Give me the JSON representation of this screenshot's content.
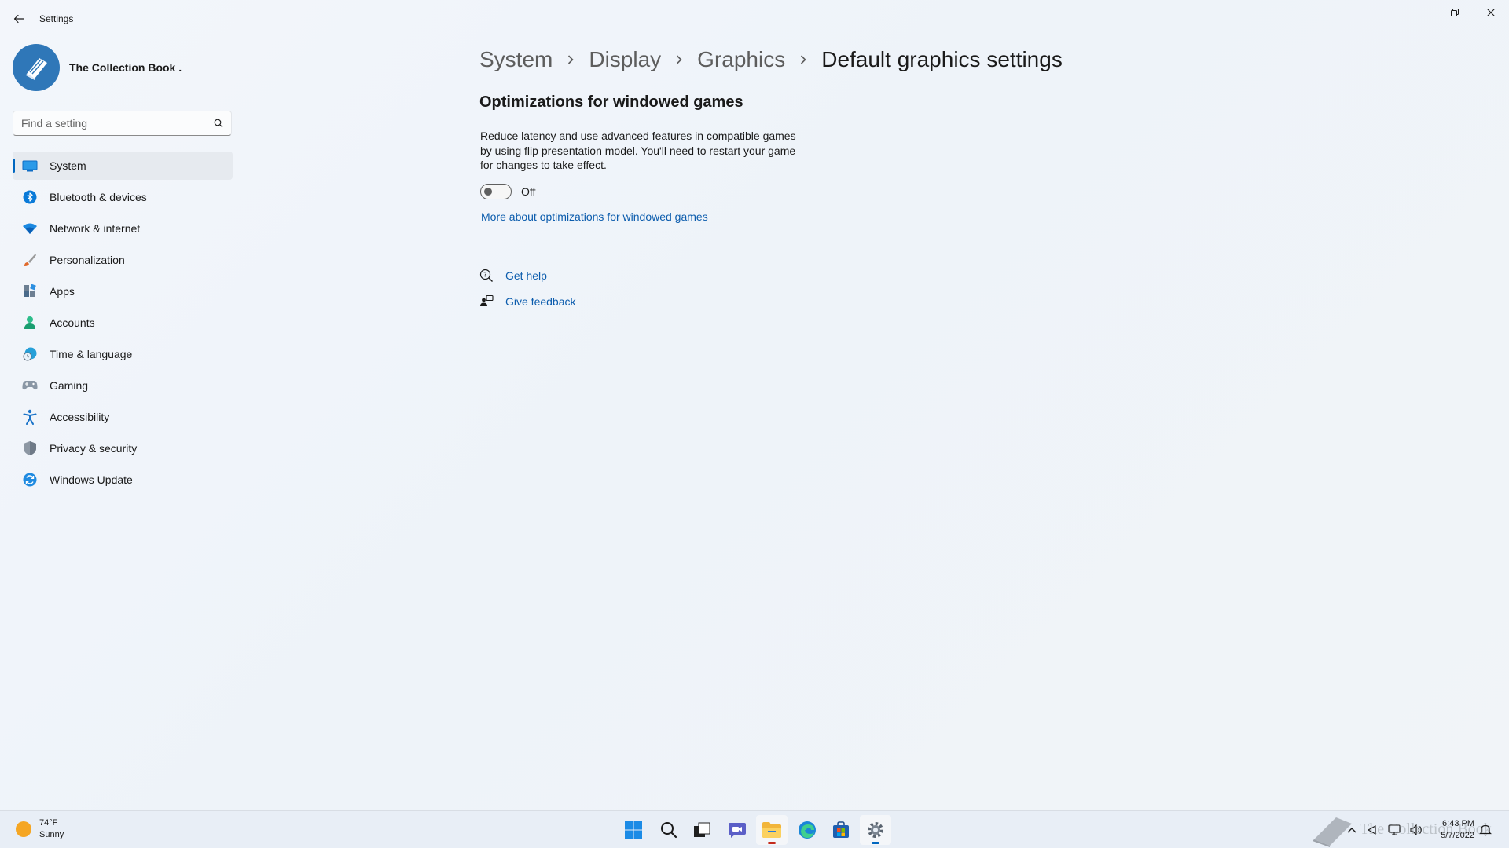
{
  "window": {
    "app_title": "Settings"
  },
  "profile": {
    "name": "The Collection Book ."
  },
  "search": {
    "placeholder": "Find a setting"
  },
  "sidebar": {
    "items": [
      {
        "label": "System",
        "icon": "monitor-icon",
        "active": true
      },
      {
        "label": "Bluetooth & devices",
        "icon": "bluetooth-icon"
      },
      {
        "label": "Network & internet",
        "icon": "wifi-icon"
      },
      {
        "label": "Personalization",
        "icon": "brush-icon"
      },
      {
        "label": "Apps",
        "icon": "apps-icon"
      },
      {
        "label": "Accounts",
        "icon": "person-icon"
      },
      {
        "label": "Time & language",
        "icon": "globe-clock-icon"
      },
      {
        "label": "Gaming",
        "icon": "gamepad-icon"
      },
      {
        "label": "Accessibility",
        "icon": "accessibility-icon"
      },
      {
        "label": "Privacy & security",
        "icon": "shield-icon"
      },
      {
        "label": "Windows Update",
        "icon": "update-icon"
      }
    ]
  },
  "breadcrumb": {
    "items": [
      "System",
      "Display",
      "Graphics"
    ],
    "current": "Default graphics settings"
  },
  "main": {
    "section_title": "Optimizations for windowed games",
    "description": "Reduce latency and use advanced features in compatible games by using flip presentation model. You'll need to restart your game for changes to take effect.",
    "toggle_state": "Off",
    "more_link": "More about optimizations for windowed games",
    "help": {
      "get_help": "Get help",
      "give_feedback": "Give feedback"
    }
  },
  "taskbar": {
    "weather_temp": "74°F",
    "weather_desc": "Sunny",
    "time": "6:43 PM",
    "date": "5/7/2022",
    "watermark": "The Collection Book"
  },
  "colors": {
    "accent": "#0067c0",
    "link": "#0b5cad",
    "background": "#eef3f9"
  }
}
